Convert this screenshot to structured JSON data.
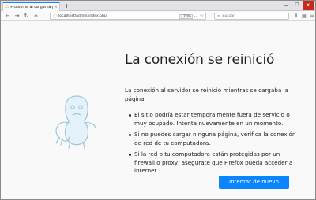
{
  "tab": {
    "title": "Problema al cargar la página",
    "close": "×"
  },
  "window_controls": {
    "minimize": "—",
    "maximize": "☐",
    "close": "✕"
  },
  "nav": {
    "back": "←",
    "forward": "→",
    "reload": "↻",
    "home": "⌂",
    "url": "localhost/admin/index.php",
    "zoom": "170%",
    "page_actions": "···",
    "bookmark": "☆"
  },
  "search": {
    "placeholder": "Buscar"
  },
  "toolbar_icons": {
    "library": "⫴",
    "sidebar": "▤",
    "menu": "≡"
  },
  "page": {
    "title": "La conexión se reinició",
    "description": "La conexión al servidor se reinició mientras se cargaba la página.",
    "tips": [
      "El sitio podría estar temporalmente fuera de servicio o muy ocupado. Intenta nuevamente en un momento.",
      "Si no puedes cargar ninguna página, verifica la conexión de red de tu computadora.",
      "Si la red o tu computadora están protegidas por un firewall o proxy, asegúrate que Firefox pueda acceder a internet."
    ],
    "retry_button": "Intentar de nuevo"
  },
  "colors": {
    "accent": "#0a84ff",
    "tab_highlight": "#0a84ff",
    "page_background": "#f9f9fa",
    "mascot_stroke": "#9fc6dc"
  }
}
